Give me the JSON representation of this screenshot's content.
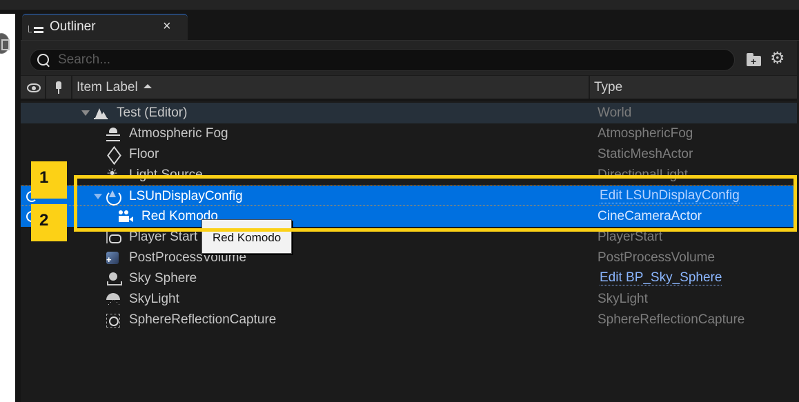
{
  "tab": {
    "title": "Outliner",
    "close_label": "×",
    "icon": "outliner-icon"
  },
  "search": {
    "placeholder": "Search...",
    "value": ""
  },
  "toolbar": {
    "add_folder_icon": "add-folder-icon",
    "settings_icon": "gear-icon",
    "settings_glyph": "⚙"
  },
  "columns": {
    "visibility_icon": "eye-icon",
    "pin_icon": "pin-icon",
    "label": "Item Label",
    "sort": "ascending",
    "type": "Type"
  },
  "rows": [
    {
      "name": "Test (Editor)",
      "type": "World",
      "icon": "world-icon",
      "expanded": true,
      "selected": false
    },
    {
      "name": "Atmospheric Fog",
      "type": "AtmosphericFog",
      "icon": "fog-icon",
      "selected": false
    },
    {
      "name": "Floor",
      "type": "StaticMeshActor",
      "icon": "static-mesh-icon",
      "selected": false
    },
    {
      "name": "Light Source",
      "type": "DirectionalLight",
      "icon": "directional-light-icon",
      "selected": false
    },
    {
      "name": "LSUnDisplayConfig",
      "type": "Edit LSUnDisplayConfig",
      "type_is_link": true,
      "icon": "ndisplay-icon",
      "expanded": true,
      "selected": true
    },
    {
      "name": "Red Komodo",
      "type": "CineCameraActor",
      "icon": "cine-camera-icon",
      "selected": true
    },
    {
      "name": "Player Start",
      "type": "PlayerStart",
      "icon": "player-start-icon",
      "selected": false
    },
    {
      "name": "PostProcessVolume",
      "type": "PostProcessVolume",
      "icon": "post-process-icon",
      "selected": false
    },
    {
      "name": "Sky Sphere",
      "type": "Edit BP_Sky_Sphere",
      "type_is_link": true,
      "icon": "sky-sphere-icon",
      "selected": false
    },
    {
      "name": "SkyLight",
      "type": "SkyLight",
      "icon": "sky-light-icon",
      "selected": false
    },
    {
      "name": "SphereReflectionCapture",
      "type": "SphereReflectionCapture",
      "icon": "reflection-capture-icon",
      "selected": false
    }
  ],
  "tooltip": {
    "text": "Red Komodo"
  },
  "annotations": [
    {
      "label": "1",
      "color": "#fcd116"
    },
    {
      "label": "2",
      "color": "#fcd116"
    }
  ],
  "colors": {
    "selection": "#0070e0",
    "highlight": "#fcd116",
    "link": "#8bb6ff"
  }
}
